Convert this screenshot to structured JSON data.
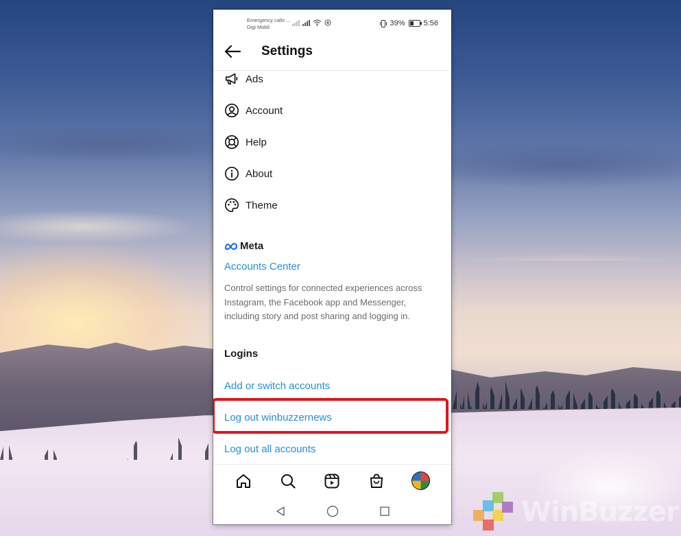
{
  "status_bar": {
    "carrier_line1": "Emergency calls ...",
    "carrier_line2": "Digi Mobil",
    "battery_percent": "39%",
    "time": "5:56"
  },
  "header": {
    "title": "Settings"
  },
  "menu": {
    "items": [
      {
        "label": "Ads",
        "icon": "megaphone-icon"
      },
      {
        "label": "Account",
        "icon": "account-circle-icon"
      },
      {
        "label": "Help",
        "icon": "lifebuoy-icon"
      },
      {
        "label": "About",
        "icon": "info-icon"
      },
      {
        "label": "Theme",
        "icon": "palette-icon"
      }
    ]
  },
  "meta": {
    "logo_text": "Meta",
    "accounts_center": "Accounts Center",
    "description": "Control settings for connected experiences across Instagram, the Facebook app and Messenger, including story and post sharing and logging in."
  },
  "logins": {
    "section_label": "Logins",
    "add_switch": "Add or switch accounts",
    "log_out_user": "Log out winbuzzernews",
    "log_out_all": "Log out all accounts"
  },
  "bottom_nav": [
    "home-icon",
    "search-icon",
    "reels-icon",
    "shop-icon",
    "profile-avatar"
  ],
  "system_nav": [
    "back-triangle-icon",
    "home-circle-icon",
    "recents-square-icon"
  ],
  "watermark": {
    "text": "WinBuzzer"
  },
  "colors": {
    "link_blue": "#2290d8",
    "highlight_red": "#e3141c"
  }
}
